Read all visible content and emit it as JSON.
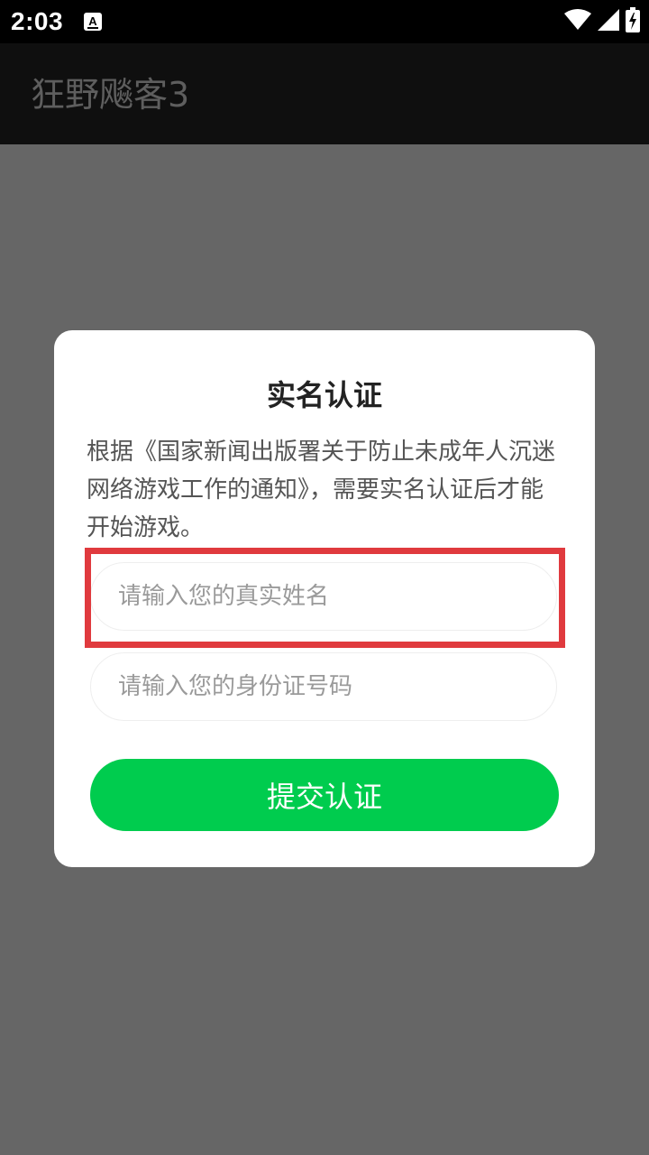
{
  "status_bar": {
    "time": "2:03",
    "icons": [
      "app-notification-icon",
      "wifi-icon",
      "signal-icon",
      "battery-charging-icon"
    ]
  },
  "app_bar": {
    "title": "狂野飚客3"
  },
  "dialog": {
    "title": "实名认证",
    "description": "根据《国家新闻出版署关于防止未成年人沉迷网络游戏工作的通知》，需要实名认证后才能开始游戏。",
    "name_field": {
      "placeholder": "请输入您的真实姓名",
      "value": ""
    },
    "id_field": {
      "placeholder": "请输入您的身份证号码",
      "value": ""
    },
    "submit_label": "提交认证"
  },
  "colors": {
    "overlay": "#666666",
    "app_bar": "#0f0f0f",
    "accent_green": "#00cc4e",
    "highlight_red": "#e03a3e"
  }
}
